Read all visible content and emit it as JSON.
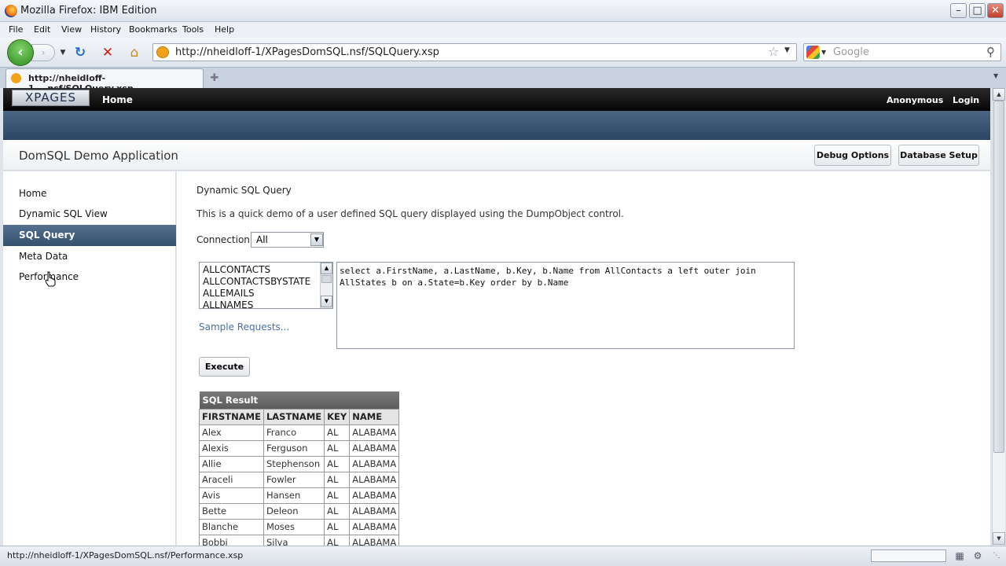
{
  "browser": {
    "window_title": "Mozilla Firefox: IBM Edition",
    "menu": [
      "File",
      "Edit",
      "View",
      "History",
      "Bookmarks",
      "Tools",
      "Help"
    ],
    "url": "http://nheidloff-1/XPagesDomSQL.nsf/SQLQuery.xsp",
    "search_placeholder": "Google",
    "tab_title": "http://nheidloff-1....nsf/SQLQuery.xsp",
    "status_text": "http://nheidloff-1/XPagesDomSQL.nsf/Performance.xsp"
  },
  "app": {
    "logo_text": "XPAGES",
    "top_nav_home": "Home",
    "user": "Anonymous",
    "login": "Login",
    "title": "DomSQL Demo Application",
    "debug_button": "Debug Options",
    "setup_button": "Database Setup"
  },
  "sidebar": {
    "items": [
      {
        "label": "Home"
      },
      {
        "label": "Dynamic SQL View"
      },
      {
        "label": "SQL Query",
        "selected": true
      },
      {
        "label": "Meta Data"
      },
      {
        "label": "Performance"
      }
    ]
  },
  "main": {
    "title": "Dynamic SQL Query",
    "description": "This is a quick demo of a user defined SQL query displayed using the DumpObject control.",
    "connection_label": "Connection:",
    "connection_value": "All",
    "tables": [
      "ALLCONTACTS",
      "ALLCONTACTSBYSTATE",
      "ALLEMAILS",
      "ALLNAMES"
    ],
    "sample_link": "Sample Requests...",
    "sql_query": "select a.FirstName, a.LastName, b.Key, b.Name from AllContacts a left outer join AllStates b on a.State=b.Key order by b.Name",
    "execute_button": "Execute"
  },
  "result": {
    "caption": "SQL Result",
    "columns": [
      "FIRSTNAME",
      "LASTNAME",
      "KEY",
      "NAME"
    ],
    "rows": [
      [
        "Alex",
        "Franco",
        "AL",
        "ALABAMA"
      ],
      [
        "Alexis",
        "Ferguson",
        "AL",
        "ALABAMA"
      ],
      [
        "Allie",
        "Stephenson",
        "AL",
        "ALABAMA"
      ],
      [
        "Araceli",
        "Fowler",
        "AL",
        "ALABAMA"
      ],
      [
        "Avis",
        "Hansen",
        "AL",
        "ALABAMA"
      ],
      [
        "Bette",
        "Deleon",
        "AL",
        "ALABAMA"
      ],
      [
        "Blanche",
        "Moses",
        "AL",
        "ALABAMA"
      ],
      [
        "Bobbi",
        "Silva",
        "AL",
        "ALABAMA"
      ]
    ]
  }
}
